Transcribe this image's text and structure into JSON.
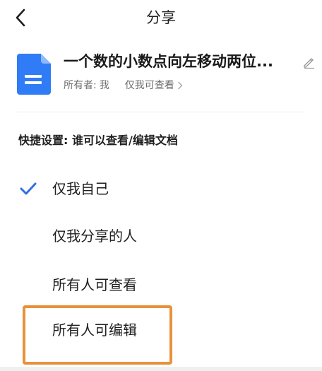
{
  "header": {
    "title": "分享"
  },
  "document": {
    "title": "一个数的小数点向左移动两位...",
    "owner_label": "所有者:",
    "owner_name": "我",
    "permission": "仅我可查看"
  },
  "quick_settings": {
    "title": "快捷设置: 谁可以查看/编辑文档",
    "options": [
      {
        "label": "仅我自己",
        "selected": true
      },
      {
        "label": "仅我分享的人",
        "selected": false
      },
      {
        "label": "所有人可查看",
        "selected": false
      },
      {
        "label": "所有人可编辑",
        "selected": false
      }
    ]
  },
  "colors": {
    "accent": "#2f6fdf",
    "doc_icon": "#2f7cf6",
    "highlight": "#e8913a"
  },
  "icons": {
    "back": "chevron-left-icon",
    "document": "doc-file-icon",
    "edit": "pencil-icon",
    "check": "check-icon",
    "arrow": "chevron-right-icon"
  }
}
